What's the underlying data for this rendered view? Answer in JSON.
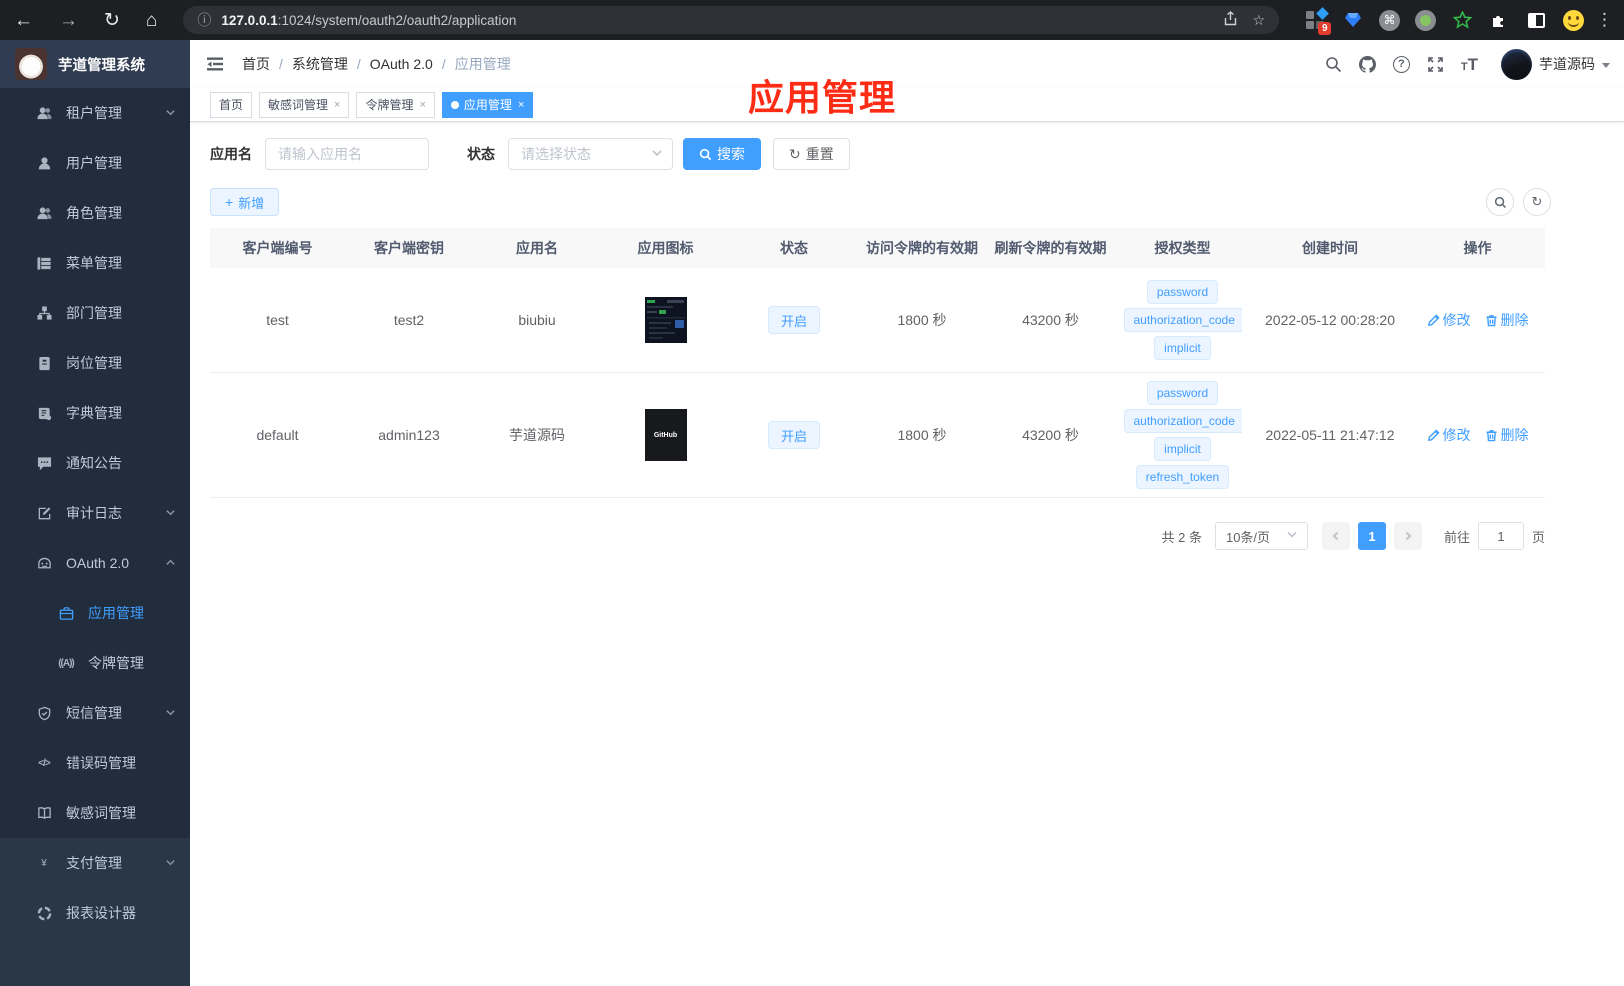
{
  "colors": {
    "accent": "#409eff",
    "annotation_red": "#fe2c15",
    "sidebar_bg": "#293747",
    "submenu_bg": "#212d3c"
  },
  "browser": {
    "url_host": "127.0.0.1",
    "url_path": ":1024/system/oauth2/oauth2/application",
    "extension_badge": "9"
  },
  "icons": {
    "back": "←",
    "forward": "→",
    "reload": "↻",
    "home": "⌂",
    "info": "ⓘ",
    "star": "☆",
    "overflow": "⋮",
    "command": "⌘",
    "plus": "+",
    "reset": "↻",
    "refresh_small": "↻",
    "question": "?",
    "t_small": "T",
    "t_large": "T",
    "yen": "¥",
    "code": "</>",
    "token": "((A))"
  },
  "sidebar": {
    "logo_title": "芋道管理系统",
    "items": [
      {
        "label": "租户管理"
      },
      {
        "label": "用户管理"
      },
      {
        "label": "角色管理"
      },
      {
        "label": "菜单管理"
      },
      {
        "label": "部门管理"
      },
      {
        "label": "岗位管理"
      },
      {
        "label": "字典管理"
      },
      {
        "label": "通知公告"
      },
      {
        "label": "审计日志"
      },
      {
        "label": "OAuth 2.0"
      },
      {
        "label": "应用管理"
      },
      {
        "label": "令牌管理"
      },
      {
        "label": "短信管理"
      },
      {
        "label": "错误码管理"
      },
      {
        "label": "敏感词管理"
      },
      {
        "label": "支付管理"
      },
      {
        "label": "报表设计器"
      }
    ]
  },
  "header": {
    "breadcrumb": [
      "首页",
      "系统管理",
      "OAuth 2.0",
      "应用管理"
    ],
    "breadcrumb_separator": "/",
    "username": "芋道源码"
  },
  "tags_view": {
    "tabs": [
      {
        "label": "首页"
      },
      {
        "label": "敏感词管理"
      },
      {
        "label": "令牌管理"
      },
      {
        "label": "应用管理"
      }
    ],
    "close_glyph": "×"
  },
  "annotation": {
    "text": "应用管理"
  },
  "filter": {
    "name_label": "应用名",
    "name_placeholder": "请输入应用名",
    "status_label": "状态",
    "status_placeholder": "请选择状态",
    "search_label": "搜索",
    "reset_label": "重置"
  },
  "toolbar": {
    "add_label": "新增"
  },
  "table": {
    "columns": [
      "客户端编号",
      "客户端密钥",
      "应用名",
      "应用图标",
      "状态",
      "访问令牌的有效期",
      "刷新令牌的有效期",
      "授权类型",
      "创建时间",
      "操作"
    ],
    "rows": [
      {
        "client_id": "test",
        "secret": "test2",
        "name": "biubiu",
        "status": "开启",
        "access_ttl": "1800 秒",
        "refresh_ttl": "43200 秒",
        "grants": [
          "password",
          "authorization_code",
          "implicit"
        ],
        "created": "2022-05-12 00:28:20"
      },
      {
        "client_id": "default",
        "secret": "admin123",
        "name": "芋道源码",
        "icon_text": "GitHub",
        "status": "开启",
        "access_ttl": "1800 秒",
        "refresh_ttl": "43200 秒",
        "grants": [
          "password",
          "authorization_code",
          "implicit",
          "refresh_token"
        ],
        "created": "2022-05-11 21:47:12"
      }
    ],
    "actions": {
      "edit": "修改",
      "delete": "删除"
    }
  },
  "pagination": {
    "total": "共 2 条",
    "page_size": "10条/页",
    "current_page": "1",
    "goto_label": "前往",
    "goto_value": "1",
    "page_unit": "页"
  }
}
